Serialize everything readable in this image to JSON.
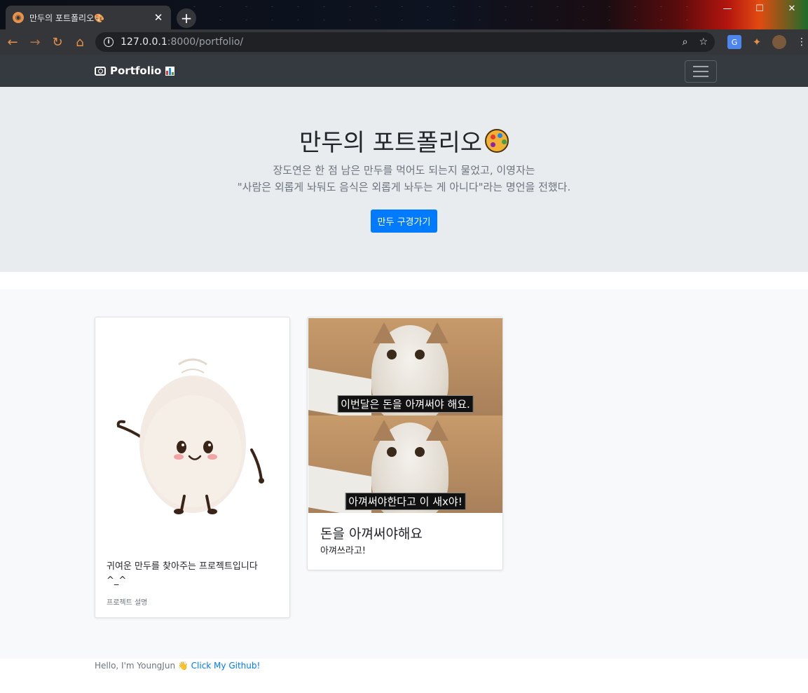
{
  "browser": {
    "tab_title": "만두의 포트폴리오🎨",
    "url_host": "127.0.0.1",
    "url_path": ":8000/portfolio/"
  },
  "navbar": {
    "brand": "Portfolio"
  },
  "hero": {
    "title": "만두의 포트폴리오",
    "lead_line1": "장도연은 한 점 남은 만두를 먹어도 되는지 물었고, 이영자는",
    "lead_line2": "\"사람은 외롭게 놔둬도 음식은 외롭게 놔두는 게 아니다\"라는 명언을 전했다.",
    "button": "만두 구경가기"
  },
  "cards": [
    {
      "text": "귀여운 만두를 찾아주는 프로젝트입니다 ^_^",
      "muted": "프로젝트 설명"
    },
    {
      "caption_top": "이번달은 돈을 아껴써야 해요.",
      "caption_bottom": "아껴써야한다고 이 새x야!",
      "title": "돈을 아껴써야해요",
      "text": "아껴쓰라고!"
    }
  ],
  "footer": {
    "text": "Hello, I'm YoungJun 👋",
    "link": "Click My Github!"
  },
  "colors": {
    "navbar": "#343a40",
    "jumbotron": "#e9ecef",
    "primary": "#007bff"
  }
}
